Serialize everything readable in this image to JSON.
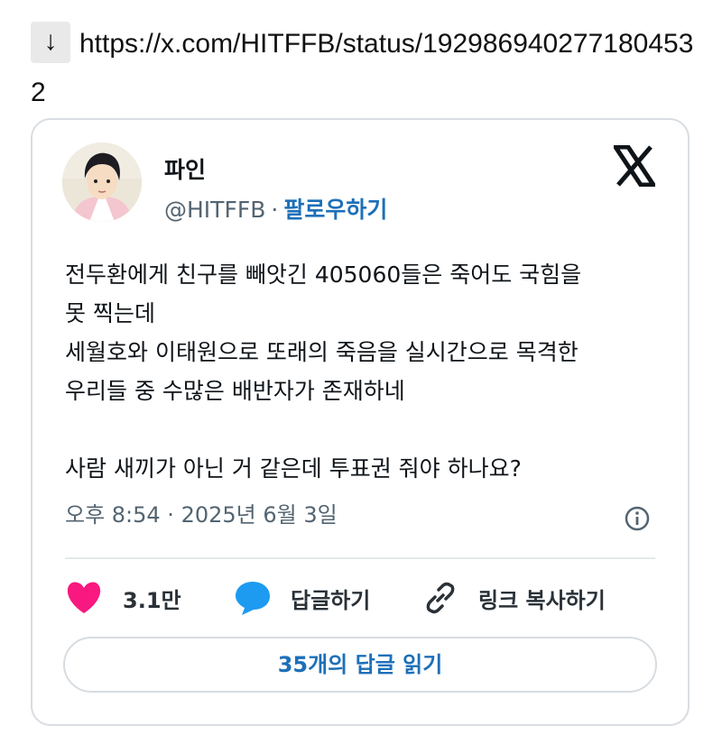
{
  "link_line": {
    "arrow": "↓",
    "url": "https://x.com/HITFFB/status/1929869402771804532"
  },
  "tweet": {
    "author_name": "파인",
    "handle": "@HITFFB",
    "separator": "·",
    "follow_label": "팔로우하기",
    "body_lines": [
      "전두환에게 친구를 빼앗긴 405060들은 죽어도 국힘을",
      "못 찍는데",
      "세월호와 이태원으로 또래의 죽음을 실시간으로 목격한",
      "우리들 중 수많은 배반자가 존재하네",
      "",
      "사람 새끼가 아닌 거 같은데 투표권 줘야 하나요?"
    ],
    "timestamp": "오후 8:54 · 2025년 6월 3일",
    "like_count": "3.1만",
    "reply_label": "답글하기",
    "copy_link_label": "링크 복사하기",
    "read_replies_label": "35개의 답글 읽기"
  },
  "colors": {
    "like_heart": "#f91880",
    "reply_bubble": "#1d9bf0",
    "follow_link": "#1d6fb8",
    "muted_text": "#536471"
  },
  "icons": [
    "down-arrow-icon",
    "avatar",
    "x-logo-icon",
    "info-icon",
    "heart-icon",
    "reply-bubble-icon",
    "link-icon"
  ]
}
